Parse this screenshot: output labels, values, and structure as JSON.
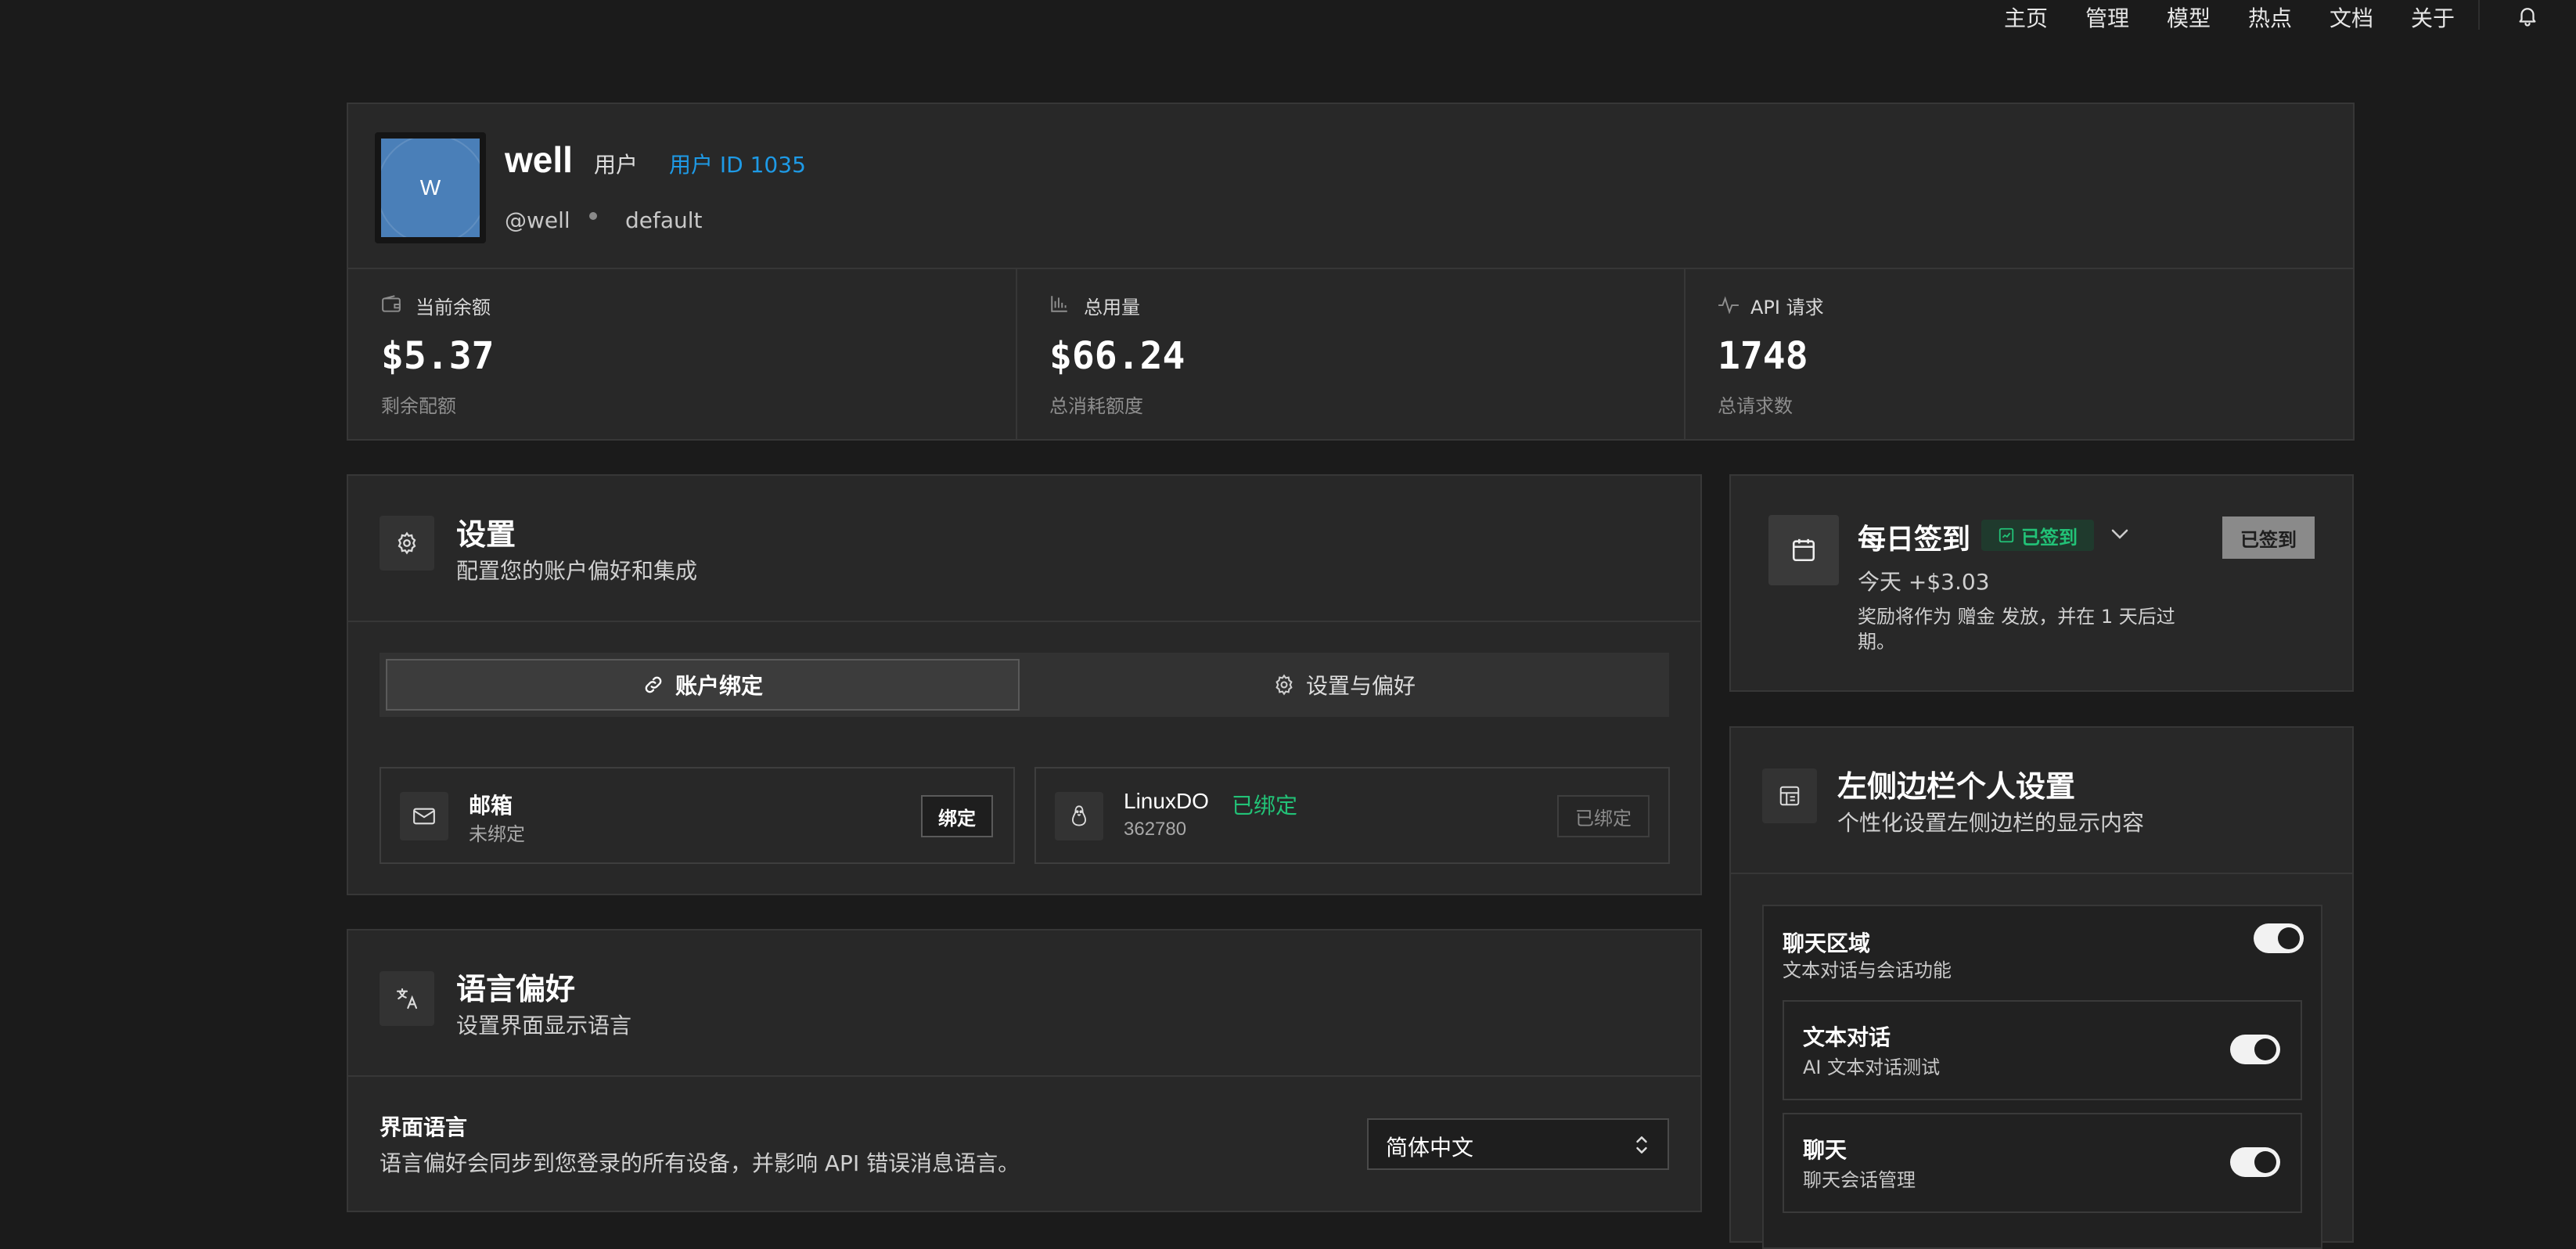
{
  "nav": {
    "items": [
      "主页",
      "管理",
      "模型",
      "热点",
      "文档",
      "关于"
    ],
    "bell_icon": "bell-icon"
  },
  "profile": {
    "avatar_letter": "W",
    "name": "well",
    "role": "用户",
    "user_id": "用户 ID 1035",
    "handle": "@well",
    "group": "default"
  },
  "stats": [
    {
      "label": "当前余额",
      "value": "$5.37",
      "sub": "剩余配额",
      "icon": "wallet-icon"
    },
    {
      "label": "总用量",
      "value": "$66.24",
      "sub": "总消耗额度",
      "icon": "bar-chart-icon"
    },
    {
      "label": "API 请求",
      "value": "1748",
      "sub": "总请求数",
      "icon": "activity-icon"
    }
  ],
  "settings": {
    "title": "设置",
    "subtitle": "配置您的账户偏好和集成",
    "tabs": [
      "账户绑定",
      "设置与偏好"
    ],
    "active_tab": "账户绑定",
    "bindings": {
      "email": {
        "title": "邮箱",
        "status": "未绑定",
        "button": "绑定"
      },
      "linuxdo": {
        "title": "LinuxDO",
        "badge": "已绑定",
        "id": "362780",
        "button": "已绑定"
      }
    }
  },
  "language": {
    "title": "语言偏好",
    "subtitle": "设置界面显示语言",
    "field_label": "界面语言",
    "field_desc": "语言偏好会同步到您登录的所有设备，并影响 API 错误消息语言。",
    "selected": "简体中文"
  },
  "checkin": {
    "title": "每日签到",
    "badge": "已签到",
    "today": "今天 +$3.03",
    "note_line1": "奖励将作为 赠金 发放，并在 1 天后过",
    "note_line2": "期。",
    "button": "已签到"
  },
  "sidebar_settings": {
    "title": "左侧边栏个人设置",
    "subtitle": "个性化设置左侧边栏的显示内容",
    "section": {
      "title": "聊天区域",
      "desc": "文本对话与会话功能",
      "enabled": true
    },
    "items": [
      {
        "title": "文本对话",
        "desc": "AI 文本对话测试",
        "enabled": true
      },
      {
        "title": "聊天",
        "desc": "聊天会话管理",
        "enabled": true
      }
    ]
  },
  "colors": {
    "background": "#1b1b1b",
    "card": "#282828",
    "accent_green": "#22c277",
    "accent_blue": "#1e9ae6",
    "avatar": "#4a7fb8"
  }
}
